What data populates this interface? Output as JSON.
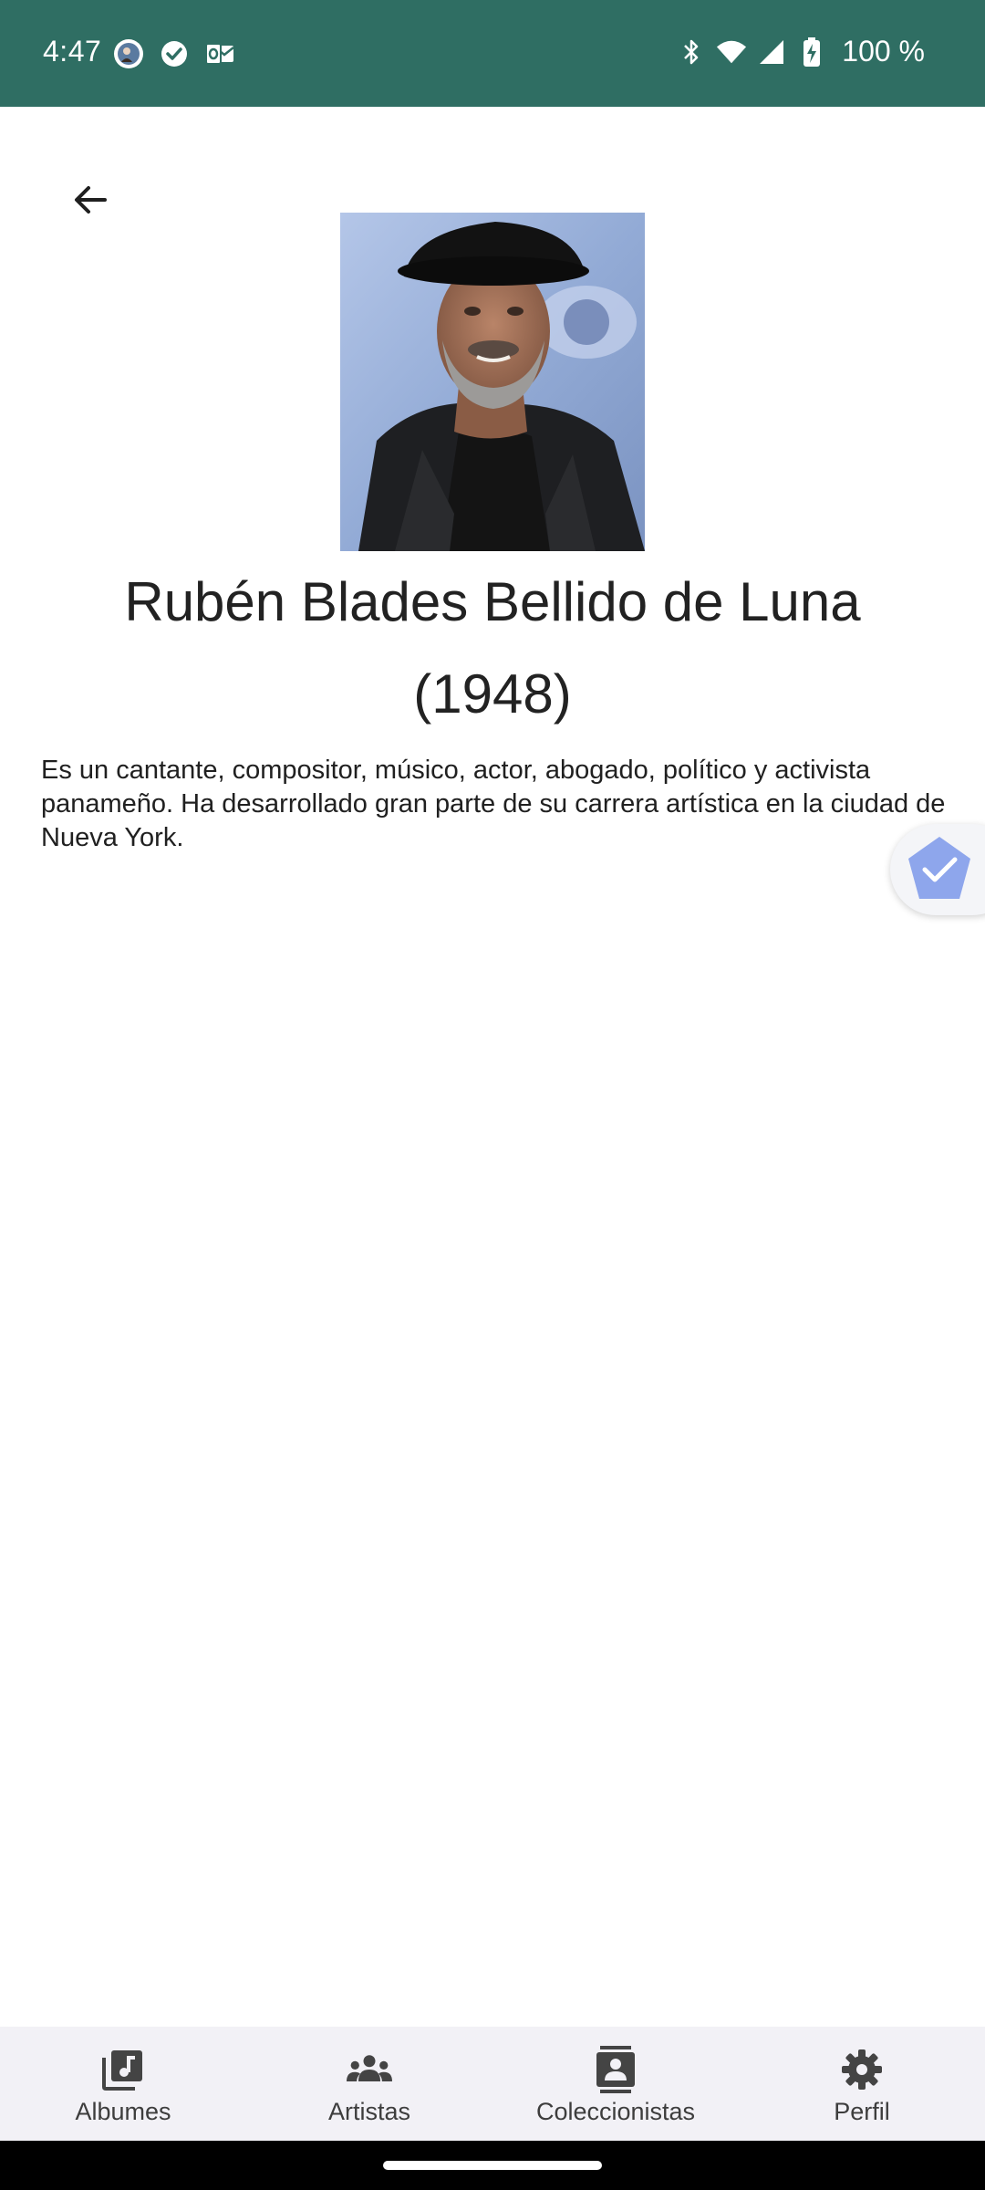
{
  "status_bar": {
    "time": "4:47",
    "battery": "100 %",
    "background_color": "#2f6e63",
    "left_icons": [
      "avatar-notification-icon",
      "check-circle-icon",
      "outlook-icon"
    ],
    "right_icons": [
      "bluetooth-icon",
      "wifi-icon",
      "cellular-signal-icon",
      "battery-charging-icon"
    ]
  },
  "header": {
    "back_icon": "arrow-back-icon"
  },
  "artist": {
    "name": "Rubén Blades Bellido de Luna",
    "year": "(1948)",
    "description": "Es un cantante, compositor, músico, actor, abogado, político y activista panameño. Ha desarrollado gran parte de su carrera artística en la ciudad de Nueva York."
  },
  "floating_badge": {
    "icon": "check-badge-icon",
    "color": "#8ea6ec"
  },
  "bottom_nav": {
    "items": [
      {
        "label": "Albumes",
        "icon": "music-library-icon"
      },
      {
        "label": "Artistas",
        "icon": "groups-icon"
      },
      {
        "label": "Coleccionistas",
        "icon": "contact-card-icon"
      },
      {
        "label": "Perfil",
        "icon": "settings-gear-icon"
      }
    ]
  }
}
